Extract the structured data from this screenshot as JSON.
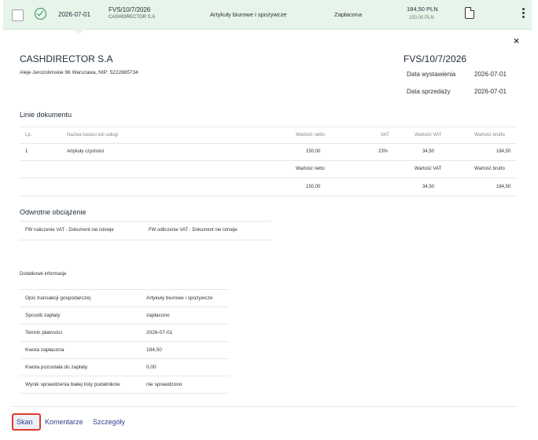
{
  "row": {
    "date": "2026-07-01",
    "doc_number": "FVS/10/7/2026",
    "company": "CASHDIRECTOR S.A",
    "category": "Artykuły biurowe i spożywcze",
    "status": "Zapłacona",
    "amount": "184,50 PLN",
    "amount_sub": "150,00 PLN",
    "icons": [
      "checkbox-icon",
      "check-circle-icon",
      "document-icon",
      "kebab-icon"
    ],
    "accent_color": "#e6f4ea"
  },
  "detail": {
    "close": "×",
    "company_name": "CASHDIRECTOR S.A",
    "company_address": "Aleje Jerozolimskie 96 Warszawa, NIP: 5222885734",
    "doc_number": "FVS/10/7/2026",
    "issue_label": "Data wystawienia",
    "issue_date": "2026-07-01",
    "sale_label": "Data sprzedaży",
    "sale_date": "2026-07-01"
  },
  "lines": {
    "title": "Linie dokumentu",
    "headers": {
      "lp": "Lp.",
      "name": "Nazwa towaru lub usługi",
      "net": "Wartość netto",
      "vat": "VAT",
      "vat_value": "Wartość VAT",
      "gross": "Wartość brutto"
    },
    "items": [
      {
        "lp": "1",
        "name": "Artykuły czystości",
        "net": "150,00",
        "vat": "23%",
        "vat_value": "34,50",
        "gross": "184,50"
      }
    ],
    "totals_headers": {
      "net": "Wartość netto",
      "vat_value": "Wartość VAT",
      "gross": "Wartość brutto"
    },
    "totals": {
      "net": "150,00",
      "vat_value": "34,50",
      "gross": "184,50"
    }
  },
  "reverse": {
    "title": "Odwrotne obciążenie",
    "item1": "FW naliczenie VAT - Dokument nie istnieje",
    "item2": "FW odliczenie VAT - Dokument nie istnieje"
  },
  "additional": {
    "title": "Dodatkowe informacje",
    "rows": [
      {
        "k": "Opis transakcji gospodarczej",
        "v": "Artykuły biurowe i spożywcze"
      },
      {
        "k": "Sposób zapłaty",
        "v": "zapłacono"
      },
      {
        "k": "Termin płatności",
        "v": "2026-07-01"
      },
      {
        "k": "Kwota zapłacona",
        "v": "184,50"
      },
      {
        "k": "Kwota pozostała do zapłaty",
        "v": "0,00"
      },
      {
        "k": "Wynik sprawdzenia białej listy podatników",
        "v": "nie sprawdzono"
      }
    ]
  },
  "tabs": {
    "scan": "Skan",
    "comments": "Komentarze",
    "details": "Szczegóły"
  }
}
